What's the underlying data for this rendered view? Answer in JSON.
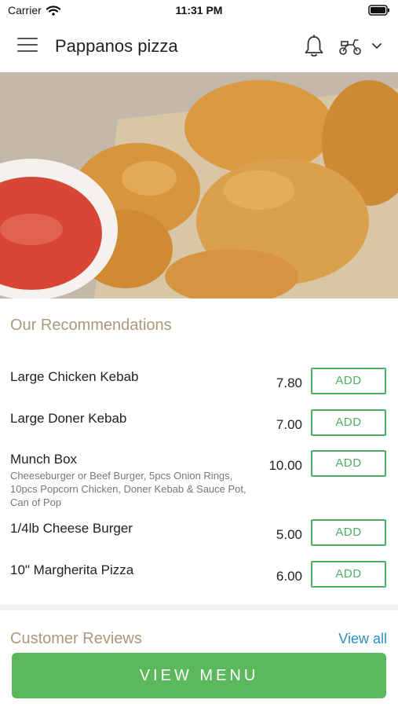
{
  "status_bar": {
    "carrier": "Carrier",
    "time": "11:31 PM"
  },
  "header": {
    "title": "Pappanos pizza"
  },
  "recommendations": {
    "title": "Our Recommendations",
    "items": [
      {
        "name": "Large Chicken Kebab",
        "description": "",
        "price": "7.80",
        "add_label": "ADD"
      },
      {
        "name": "Large Doner Kebab",
        "description": "",
        "price": "7.00",
        "add_label": "ADD"
      },
      {
        "name": "Munch Box",
        "description": "Cheeseburger or Beef Burger, 5pcs Onion Rings, 10pcs Popcorn Chicken, Doner Kebab & Sauce Pot, Can of Pop",
        "price": "10.00",
        "add_label": "ADD"
      },
      {
        "name": "1/4lb Cheese Burger",
        "description": "",
        "price": "5.00",
        "add_label": "ADD"
      },
      {
        "name": "10\" Margherita Pizza",
        "description": "",
        "price": "6.00",
        "add_label": "ADD"
      }
    ]
  },
  "reviews": {
    "title": "Customer Reviews",
    "view_all": "View all"
  },
  "cta": {
    "label": "VIEW MENU"
  },
  "colors": {
    "accent_green": "#4caf66",
    "section_title": "#a89a7a",
    "link": "#2a8fc4"
  }
}
